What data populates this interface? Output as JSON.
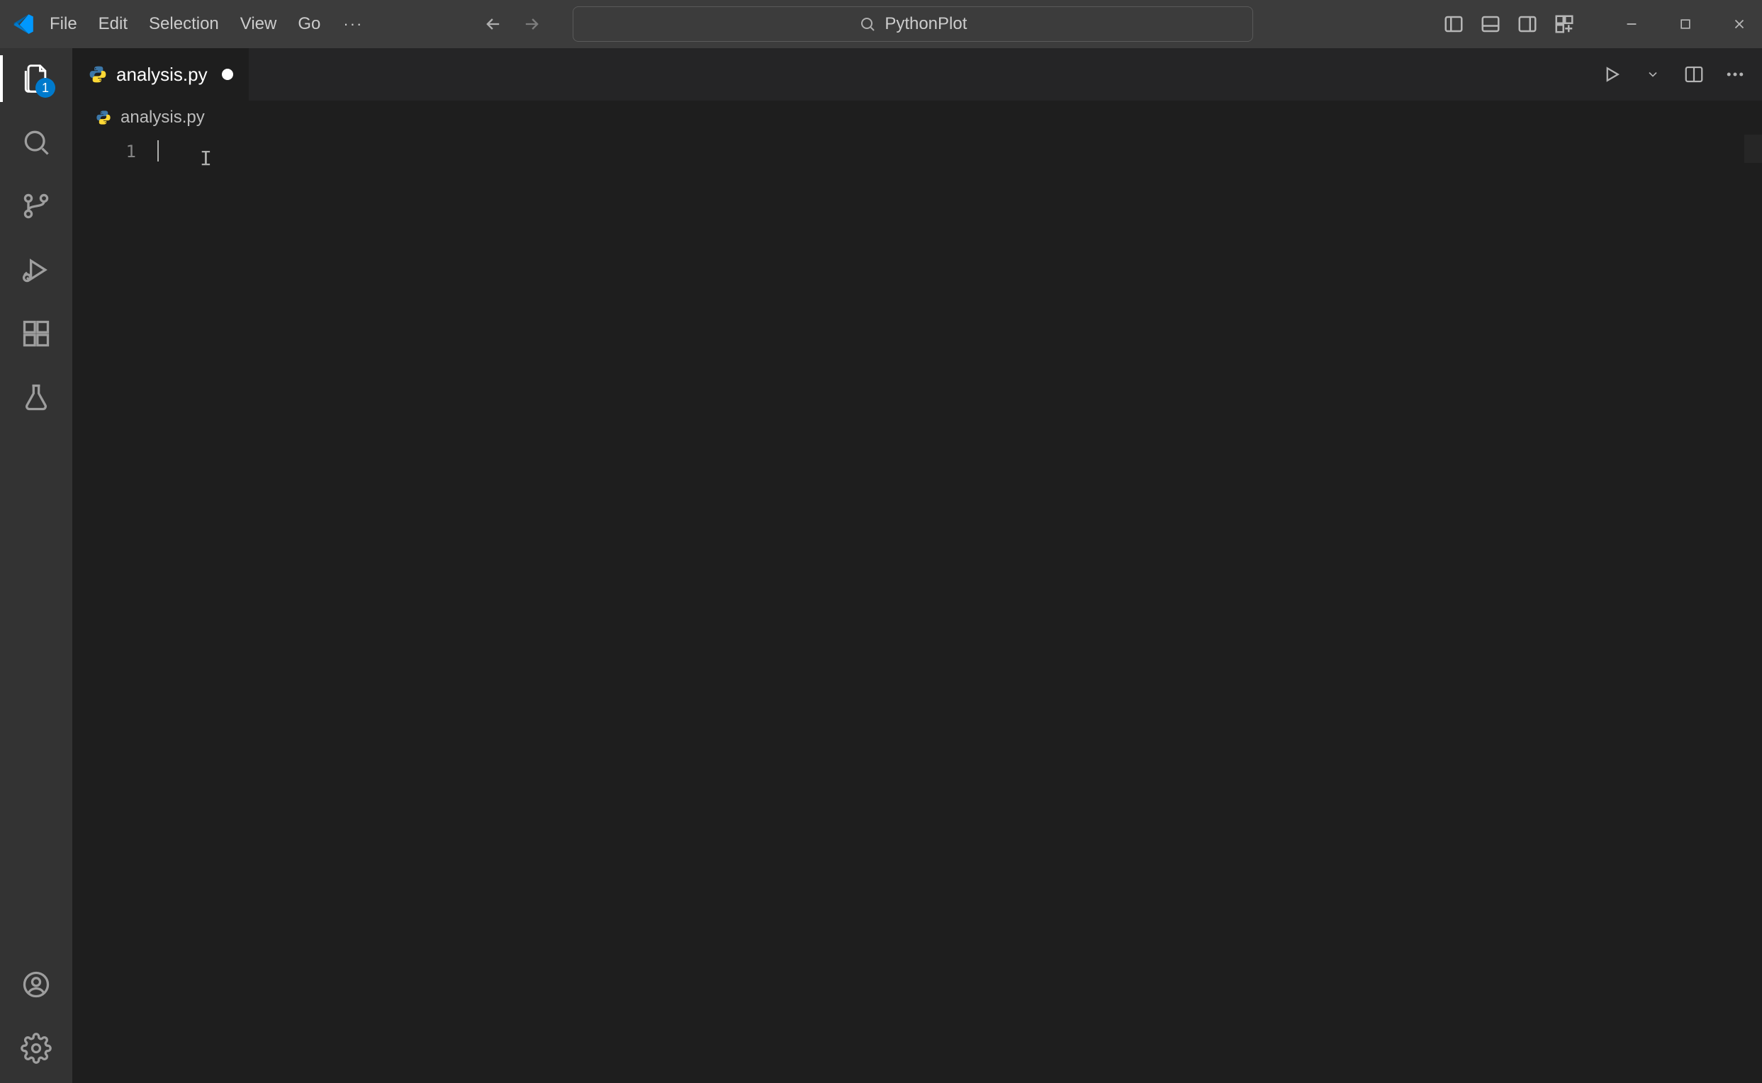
{
  "titlebar": {
    "menu": [
      "File",
      "Edit",
      "Selection",
      "View",
      "Go"
    ],
    "more_glyph": "···",
    "search_text": "PythonPlot"
  },
  "activity": {
    "explorer_badge": "1"
  },
  "tabs": {
    "items": [
      {
        "label": "analysis.py",
        "dirty": true,
        "icon": "python-icon"
      }
    ]
  },
  "breadcrumb": {
    "text": "analysis.py"
  },
  "editor": {
    "gutter_lines": [
      "1"
    ],
    "code_lines": [
      ""
    ]
  }
}
